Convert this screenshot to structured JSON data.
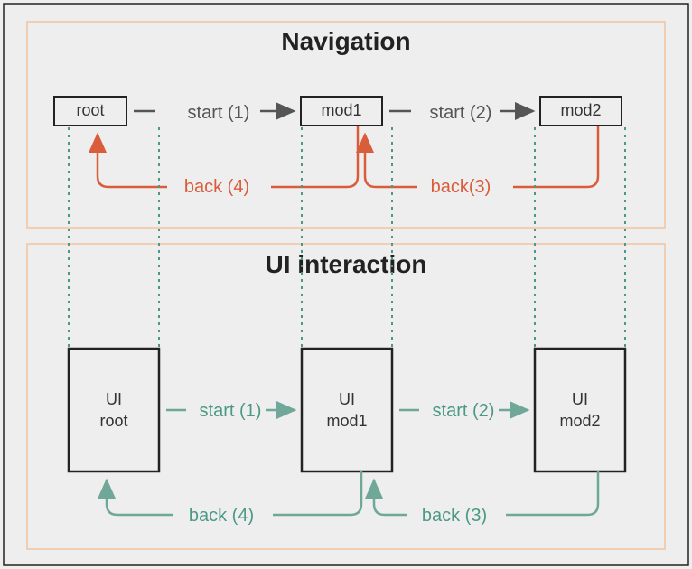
{
  "nav": {
    "title": "Navigation",
    "nodes": {
      "root": "root",
      "mod1": "mod1",
      "mod2": "mod2"
    },
    "forward": {
      "s1": "start (1)",
      "s2": "start (2)"
    },
    "back": {
      "b3": "back(3)",
      "b4": "back (4)"
    }
  },
  "ui": {
    "title": "UI interaction",
    "nodes": {
      "root": {
        "l1": "UI",
        "l2": "root"
      },
      "mod1": {
        "l1": "UI",
        "l2": "mod1"
      },
      "mod2": {
        "l1": "UI",
        "l2": "mod2"
      }
    },
    "forward": {
      "s1": "start (1)",
      "s2": "start (2)"
    },
    "back": {
      "b3": "back (3)",
      "b4": "back (4)"
    }
  }
}
